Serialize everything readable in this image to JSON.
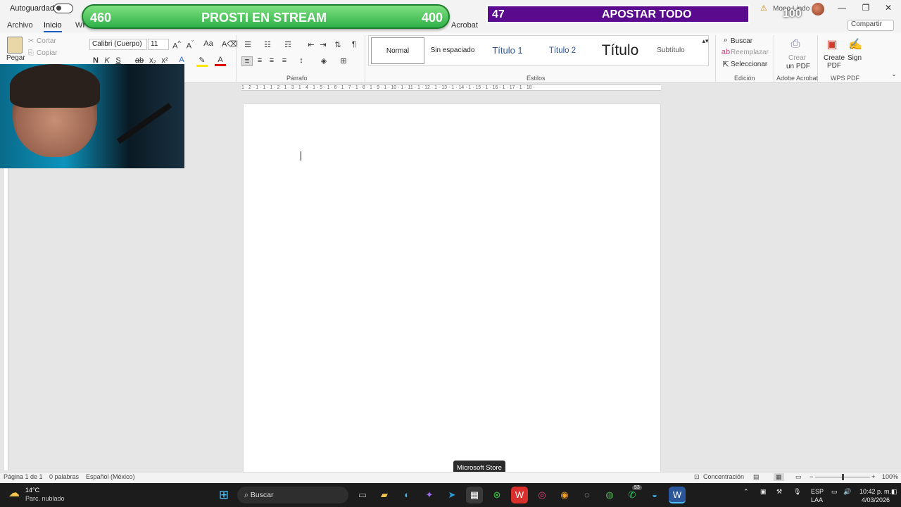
{
  "titlebar": {
    "autosave_label": "Autoguardado",
    "user_name": "Mono Lindo",
    "warning_icon": "warning-icon",
    "window_buttons": [
      "—",
      "❐",
      "✕"
    ]
  },
  "overlay": {
    "green": {
      "left": "460",
      "center": "PROSTI EN STREAM",
      "right": "400"
    },
    "purple": {
      "left": "47",
      "center": "APOSTAR TODO"
    },
    "score": "100"
  },
  "tabs": {
    "archivo": "Archivo",
    "inicio": "Inicio",
    "wp": "WP",
    "acrobat": "Acrobat",
    "share": "Compartir"
  },
  "clipboard": {
    "paste": "Pegar",
    "cut": "Cortar",
    "copy": "Copiar"
  },
  "font": {
    "family": "Calibri (Cuerpo)",
    "size": "11",
    "bold": "N",
    "italic": "K",
    "underline": "S"
  },
  "groups": {
    "paragraph": "Párrafo",
    "styles": "Estilos",
    "editing": "Edición",
    "acrobat": "Adobe Acrobat",
    "wps": "WPS PDF"
  },
  "styles": {
    "normal": "Normal",
    "no_spacing": "Sin espaciado",
    "h1": "Título 1",
    "h2": "Título 2",
    "title": "Título",
    "subtitle": "Subtítulo"
  },
  "editing": {
    "find": "Buscar",
    "replace": "Reemplazar",
    "select": "Seleccionar"
  },
  "acrobat": {
    "create": "Crear",
    "pdf": "un PDF"
  },
  "wps": {
    "create": "Create",
    "pdf": "PDF",
    "sign": "Sign"
  },
  "ruler": {
    "ticks": "1 · 2 · 1 · 1 · 1 · 2 · 1 · 3 · 1 · 4 · 1 · 5 · 1 · 6 · 1 · 7 · 1 · 8 · 1 · 9 · 1 · 10 · 1 · 11 · 1 · 12 · 1 · 13 · 1 · 14 · 1 · 15 · 1 · 16 · 1 · 17 · 1 · 18 ·"
  },
  "statusbar": {
    "page": "Página 1 de 1",
    "words": "0 palabras",
    "language": "Español (México)",
    "focus": "Concentración",
    "zoom": "100%",
    "zoom_level": 0.5
  },
  "tooltip": "Microsoft Store",
  "taskbar": {
    "weather_temp": "14°C",
    "weather_desc": "Parc. nublado",
    "search": "Buscar",
    "lang1": "ESP",
    "lang2": "LAA",
    "time": "10:42 p. m.",
    "date": "4/03/2026",
    "badge": "53"
  }
}
